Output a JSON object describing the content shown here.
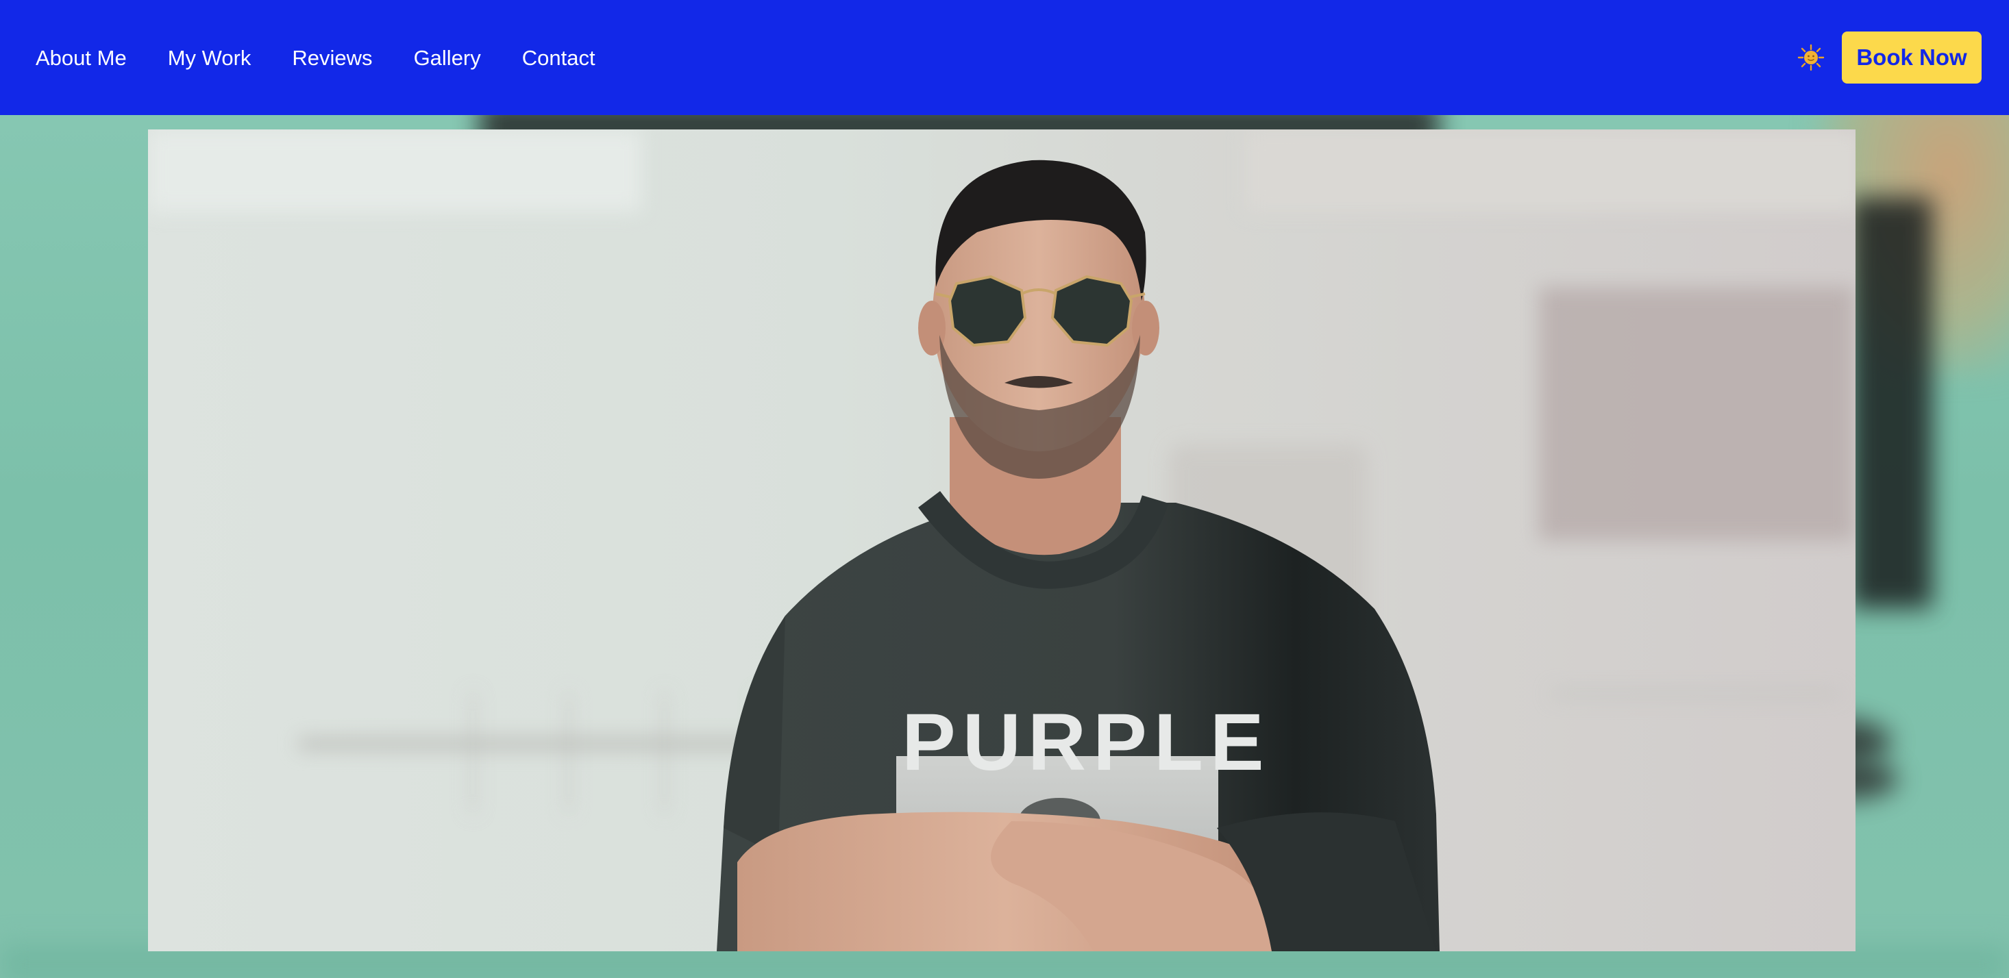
{
  "nav": {
    "items": [
      {
        "label": "About Me"
      },
      {
        "label": "My Work"
      },
      {
        "label": "Reviews"
      },
      {
        "label": "Gallery"
      },
      {
        "label": "Contact"
      }
    ]
  },
  "header": {
    "theme_icon": "sun-icon",
    "book_label": "Book Now"
  },
  "hero": {
    "shirt_text": "PURPLE"
  },
  "colors": {
    "header_bg": "#1228e8",
    "accent_button": "#fcd94b",
    "button_text": "#1228e8",
    "hero_bg": "#86c7b2"
  }
}
